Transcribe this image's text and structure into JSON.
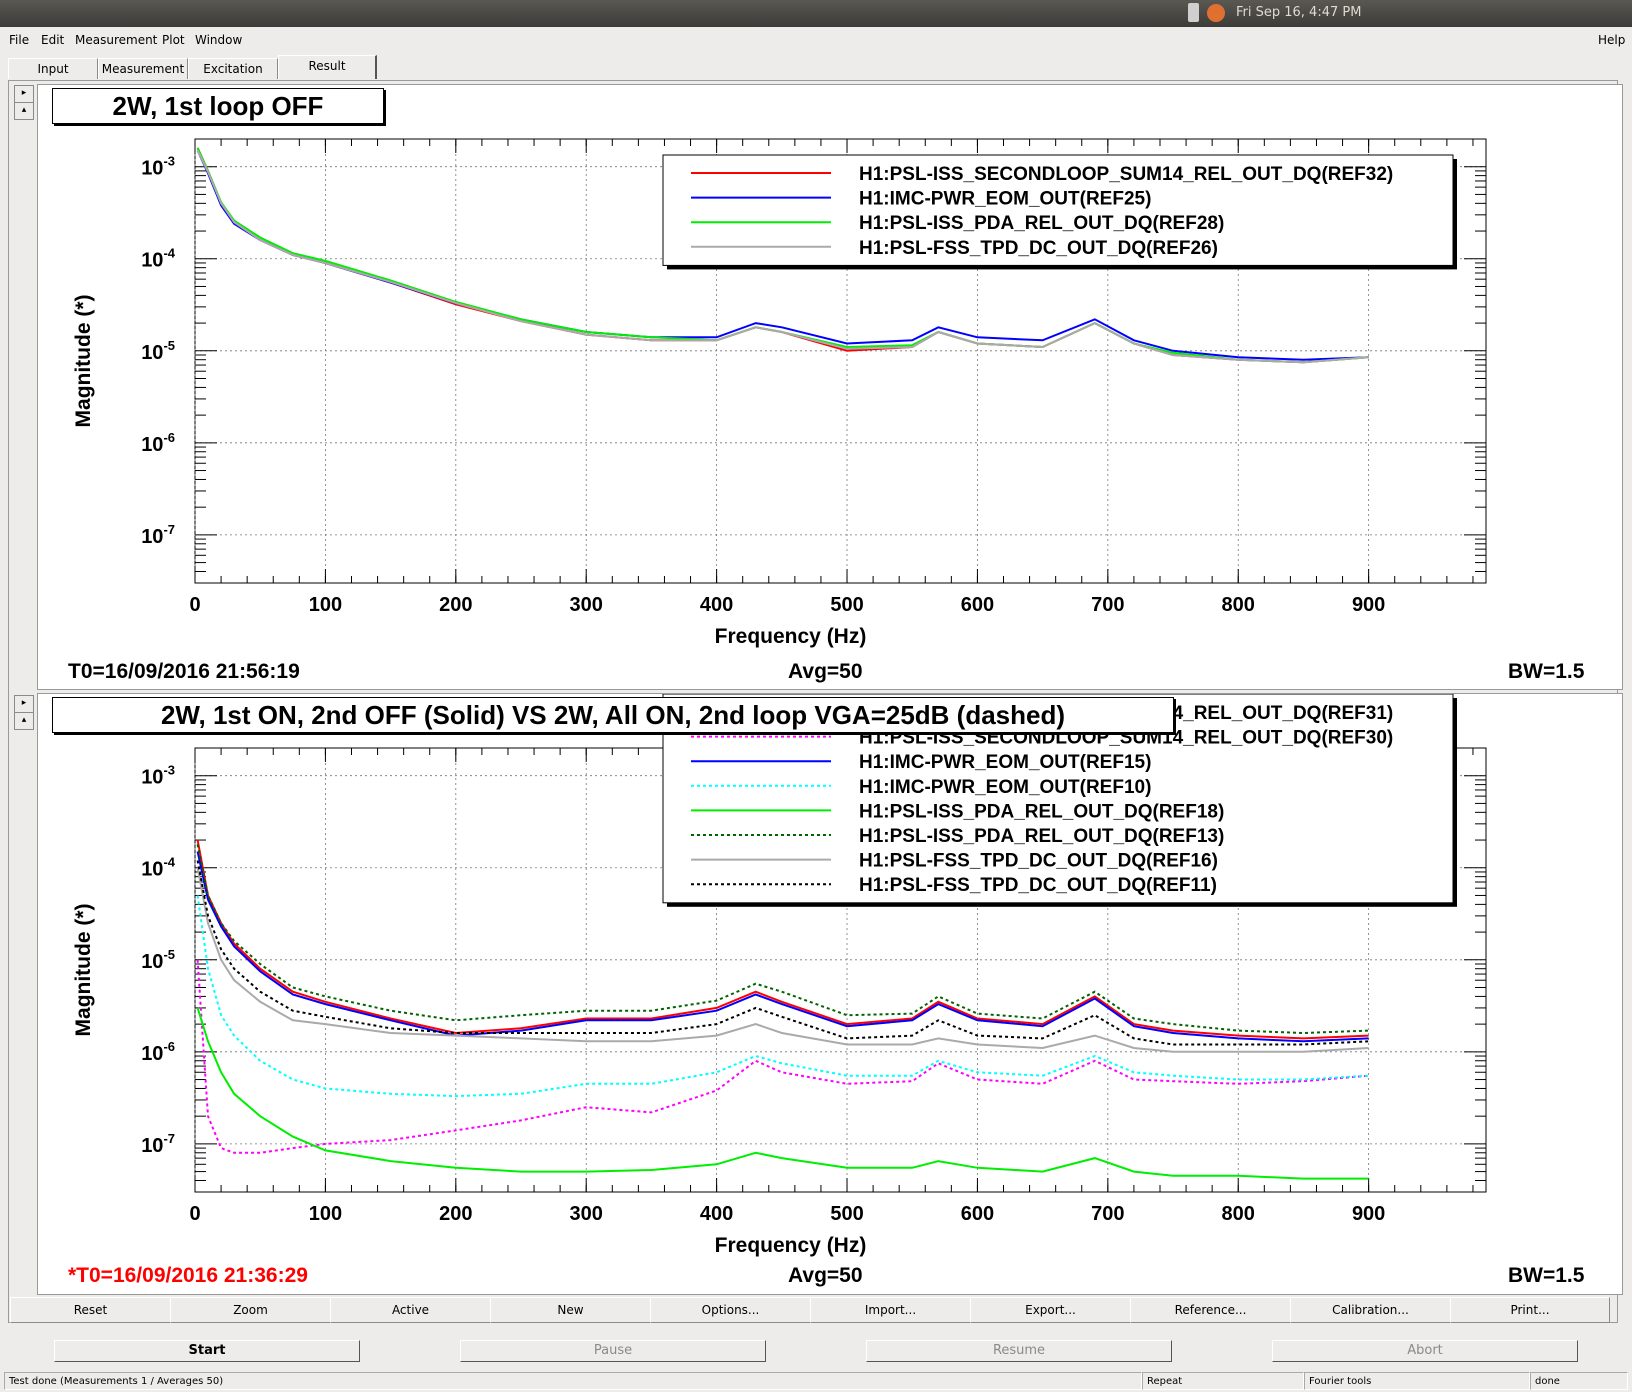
{
  "system": {
    "clock": "Fri Sep 16,  4:47 PM"
  },
  "menu": {
    "file": "File",
    "edit": "Edit",
    "measurement": "Measurement",
    "plot": "Plot",
    "window": "Window",
    "help": "Help"
  },
  "tabs": {
    "input": "Input",
    "measurement": "Measurement",
    "excitation": "Excitation",
    "result": "Result"
  },
  "plot1": {
    "title": "2W, 1st loop OFF",
    "ylabel": "Magnitude (*)",
    "xlabel": "Frequency (Hz)",
    "t0": "T0=16/09/2016 21:56:19",
    "avg": "Avg=50",
    "bw": "BW=1.5",
    "legend": [
      {
        "label": "H1:PSL-ISS_SECONDLOOP_SUM14_REL_OUT_DQ(REF32)",
        "color": "#ff0000",
        "dash": false
      },
      {
        "label": "H1:IMC-PWR_EOM_OUT(REF25)",
        "color": "#0000ff",
        "dash": false
      },
      {
        "label": "H1:PSL-ISS_PDA_REL_OUT_DQ(REF28)",
        "color": "#00ee00",
        "dash": false
      },
      {
        "label": "H1:PSL-FSS_TPD_DC_OUT_DQ(REF26)",
        "color": "#aaaaaa",
        "dash": false
      }
    ]
  },
  "plot2": {
    "title": "2W, 1st ON, 2nd OFF (Solid) VS 2W, All ON, 2nd loop VGA=25dB (dashed)",
    "ylabel": "Magnitude (*)",
    "xlabel": "Frequency (Hz)",
    "t0": "*T0=16/09/2016 21:36:29",
    "t0_color": "#ff0000",
    "avg": "Avg=50",
    "bw": "BW=1.5",
    "legend": [
      {
        "label": "H1:PSL-ISS_SECONDLOOP_SUM14_REL_OUT_DQ(REF31)",
        "color": "#ff0000",
        "dash": false
      },
      {
        "label": "H1:PSL-ISS_SECONDLOOP_SUM14_REL_OUT_DQ(REF30)",
        "color": "#ff00ff",
        "dash": true
      },
      {
        "label": "H1:IMC-PWR_EOM_OUT(REF15)",
        "color": "#0000ff",
        "dash": false
      },
      {
        "label": "H1:IMC-PWR_EOM_OUT(REF10)",
        "color": "#00ffff",
        "dash": true
      },
      {
        "label": "H1:PSL-ISS_PDA_REL_OUT_DQ(REF18)",
        "color": "#00ee00",
        "dash": false
      },
      {
        "label": "H1:PSL-ISS_PDA_REL_OUT_DQ(REF13)",
        "color": "#006400",
        "dash": true
      },
      {
        "label": "H1:PSL-FSS_TPD_DC_OUT_DQ(REF16)",
        "color": "#aaaaaa",
        "dash": false
      },
      {
        "label": "H1:PSL-FSS_TPD_DC_OUT_DQ(REF11)",
        "color": "#000000",
        "dash": true
      }
    ]
  },
  "chart_data": [
    {
      "type": "line",
      "title": "2W, 1st loop OFF",
      "xlabel": "Frequency (Hz)",
      "ylabel": "Magnitude (*)",
      "xlim": [
        0,
        990
      ],
      "ylim": [
        3e-08,
        0.002
      ],
      "yscale": "log",
      "grid": true,
      "legend_position": "top-right",
      "x_ticks": [
        "0",
        "100",
        "200",
        "300",
        "400",
        "500",
        "600",
        "700",
        "800",
        "900"
      ],
      "y_ticks": [
        "10-7",
        "10-6",
        "10-5",
        "10-4",
        "10-3"
      ],
      "x": [
        2,
        10,
        20,
        30,
        50,
        75,
        100,
        150,
        200,
        250,
        300,
        350,
        400,
        430,
        450,
        500,
        550,
        570,
        600,
        650,
        690,
        720,
        750,
        800,
        850,
        900
      ],
      "series": [
        {
          "name": "H1:PSL-ISS_SECONDLOOP_SUM14_REL_OUT_DQ(REF32)",
          "values": [
            0.0016,
            0.0009,
            0.0004,
            0.00025,
            0.00016,
            0.00011,
            9e-05,
            5.5e-05,
            3.2e-05,
            2.1e-05,
            1.5e-05,
            1.3e-05,
            1.3e-05,
            1.8e-05,
            1.6e-05,
            1e-05,
            1.1e-05,
            1.6e-05,
            1.2e-05,
            1.1e-05,
            2e-05,
            1.2e-05,
            9e-06,
            8e-06,
            7.5e-06,
            8.5e-06
          ]
        },
        {
          "name": "H1:IMC-PWR_EOM_OUT(REF25)",
          "values": [
            0.0015,
            0.00085,
            0.00038,
            0.00024,
            0.00016,
            0.00011,
            9e-05,
            5.5e-05,
            3.3e-05,
            2.2e-05,
            1.6e-05,
            1.4e-05,
            1.4e-05,
            2e-05,
            1.8e-05,
            1.2e-05,
            1.3e-05,
            1.8e-05,
            1.4e-05,
            1.3e-05,
            2.2e-05,
            1.3e-05,
            1e-05,
            8.5e-06,
            8e-06,
            8.5e-06
          ]
        },
        {
          "name": "H1:PSL-ISS_PDA_REL_OUT_DQ(REF28)",
          "values": [
            0.0016,
            0.0009,
            0.00041,
            0.00026,
            0.00017,
            0.000115,
            9.5e-05,
            5.8e-05,
            3.4e-05,
            2.2e-05,
            1.6e-05,
            1.4e-05,
            1.3e-05,
            1.8e-05,
            1.6e-05,
            1.1e-05,
            1.15e-05,
            1.6e-05,
            1.2e-05,
            1.1e-05,
            2e-05,
            1.2e-05,
            9.5e-06,
            8e-06,
            7.5e-06,
            8.5e-06
          ]
        },
        {
          "name": "H1:PSL-FSS_TPD_DC_OUT_DQ(REF26)",
          "values": [
            0.0015,
            0.00088,
            0.0004,
            0.00025,
            0.00016,
            0.00011,
            9e-05,
            5.6e-05,
            3.3e-05,
            2.1e-05,
            1.5e-05,
            1.3e-05,
            1.3e-05,
            1.8e-05,
            1.6e-05,
            1.05e-05,
            1.1e-05,
            1.6e-05,
            1.2e-05,
            1.1e-05,
            2e-05,
            1.2e-05,
            9e-06,
            8e-06,
            7.5e-06,
            8.5e-06
          ]
        }
      ]
    },
    {
      "type": "line",
      "title": "2W, 1st ON, 2nd OFF (Solid) VS 2W, All ON, 2nd loop VGA=25dB (dashed)",
      "xlabel": "Frequency (Hz)",
      "ylabel": "Magnitude (*)",
      "xlim": [
        0,
        990
      ],
      "ylim": [
        3e-08,
        0.002
      ],
      "yscale": "log",
      "grid": true,
      "legend_position": "top-right",
      "x_ticks": [
        "0",
        "100",
        "200",
        "300",
        "400",
        "500",
        "600",
        "700",
        "800",
        "900"
      ],
      "y_ticks": [
        "10-7",
        "10-6",
        "10-5",
        "10-4",
        "10-3"
      ],
      "x": [
        2,
        10,
        20,
        30,
        50,
        75,
        100,
        150,
        200,
        250,
        300,
        350,
        400,
        430,
        450,
        500,
        550,
        570,
        600,
        650,
        690,
        720,
        750,
        800,
        850,
        900
      ],
      "series": [
        {
          "name": "H1:PSL-ISS_SECONDLOOP_SUM14_REL_OUT_DQ(REF31)",
          "values": [
            0.0002,
            5e-05,
            2.5e-05,
            1.5e-05,
            8e-06,
            4.5e-06,
            3.5e-06,
            2.3e-06,
            1.6e-06,
            1.8e-06,
            2.3e-06,
            2.3e-06,
            3e-06,
            4.5e-06,
            3.5e-06,
            2e-06,
            2.3e-06,
            3.5e-06,
            2.3e-06,
            2e-06,
            4e-06,
            2e-06,
            1.7e-06,
            1.5e-06,
            1.4e-06,
            1.5e-06
          ]
        },
        {
          "name": "H1:PSL-ISS_SECONDLOOP_SUM14_REL_OUT_DQ(REF30)",
          "values": [
            1e-05,
            2e-07,
            9e-08,
            8e-08,
            8e-08,
            9e-08,
            1e-07,
            1.1e-07,
            1.4e-07,
            1.8e-07,
            2.5e-07,
            2.2e-07,
            3.8e-07,
            8e-07,
            6e-07,
            4.5e-07,
            4.8e-07,
            7.5e-07,
            5e-07,
            4.5e-07,
            8e-07,
            5e-07,
            4.8e-07,
            4.5e-07,
            4.8e-07,
            5.5e-07
          ]
        },
        {
          "name": "H1:IMC-PWR_EOM_OUT(REF15)",
          "values": [
            0.00015,
            4.5e-05,
            2.3e-05,
            1.4e-05,
            7.5e-06,
            4.2e-06,
            3.3e-06,
            2.2e-06,
            1.5e-06,
            1.7e-06,
            2.2e-06,
            2.2e-06,
            2.8e-06,
            4.2e-06,
            3.3e-06,
            1.9e-06,
            2.2e-06,
            3.3e-06,
            2.2e-06,
            1.9e-06,
            3.8e-06,
            1.9e-06,
            1.6e-06,
            1.4e-06,
            1.3e-06,
            1.4e-06
          ]
        },
        {
          "name": "H1:IMC-PWR_EOM_OUT(REF10)",
          "values": [
            5e-05,
            8e-06,
            2.5e-06,
            1.5e-06,
            8e-07,
            5e-07,
            4e-07,
            3.5e-07,
            3.3e-07,
            3.5e-07,
            4.5e-07,
            4.5e-07,
            6e-07,
            9e-07,
            7.5e-07,
            5.5e-07,
            5.5e-07,
            8e-07,
            6e-07,
            5.5e-07,
            9e-07,
            6e-07,
            5.5e-07,
            5e-07,
            5e-07,
            5.5e-07
          ]
        },
        {
          "name": "H1:PSL-ISS_PDA_REL_OUT_DQ(REF18)",
          "values": [
            3e-06,
            1.3e-06,
            6e-07,
            3.5e-07,
            2e-07,
            1.2e-07,
            8.5e-08,
            6.5e-08,
            5.5e-08,
            5e-08,
            5e-08,
            5.2e-08,
            6e-08,
            8e-08,
            7e-08,
            5.5e-08,
            5.5e-08,
            6.5e-08,
            5.5e-08,
            5e-08,
            7e-08,
            5e-08,
            4.5e-08,
            4.5e-08,
            4.2e-08,
            4.2e-08
          ]
        },
        {
          "name": "H1:PSL-ISS_PDA_REL_OUT_DQ(REF13)",
          "values": [
            0.00018,
            5e-05,
            2.5e-05,
            1.6e-05,
            9e-06,
            5e-06,
            4e-06,
            2.8e-06,
            2.2e-06,
            2.5e-06,
            2.8e-06,
            2.8e-06,
            3.6e-06,
            5.5e-06,
            4.5e-06,
            2.5e-06,
            2.6e-06,
            4e-06,
            2.6e-06,
            2.3e-06,
            4.5e-06,
            2.3e-06,
            2e-06,
            1.7e-06,
            1.6e-06,
            1.7e-06
          ]
        },
        {
          "name": "H1:PSL-FSS_TPD_DC_OUT_DQ(REF16)",
          "values": [
            0.0001,
            2.5e-05,
            1e-05,
            6e-06,
            3.5e-06,
            2.2e-06,
            2e-06,
            1.6e-06,
            1.5e-06,
            1.4e-06,
            1.3e-06,
            1.3e-06,
            1.5e-06,
            2e-06,
            1.6e-06,
            1.2e-06,
            1.2e-06,
            1.4e-06,
            1.2e-06,
            1.1e-06,
            1.5e-06,
            1.1e-06,
            1e-06,
            1e-06,
            1e-06,
            1.1e-06
          ]
        },
        {
          "name": "H1:PSL-FSS_TPD_DC_OUT_DQ(REF11)",
          "values": [
            0.00012,
            3e-05,
            1.3e-05,
            8e-06,
            4.5e-06,
            2.8e-06,
            2.4e-06,
            1.8e-06,
            1.6e-06,
            1.6e-06,
            1.6e-06,
            1.6e-06,
            2e-06,
            3e-06,
            2.4e-06,
            1.4e-06,
            1.5e-06,
            2.2e-06,
            1.5e-06,
            1.4e-06,
            2.5e-06,
            1.4e-06,
            1.2e-06,
            1.2e-06,
            1.2e-06,
            1.3e-06
          ]
        }
      ]
    }
  ],
  "buttons": {
    "reset": "Reset",
    "zoom": "Zoom",
    "active": "Active",
    "new": "New",
    "options": "Options...",
    "import": "Import...",
    "export": "Export...",
    "reference": "Reference...",
    "calibration": "Calibration...",
    "print": "Print..."
  },
  "controls": {
    "start": "Start",
    "pause": "Pause",
    "resume": "Resume",
    "abort": "Abort"
  },
  "status": {
    "message": "Test done (Measurements 1 / Averages 50)",
    "repeat": "Repeat",
    "fourier": "Fourier tools",
    "state": "done"
  }
}
